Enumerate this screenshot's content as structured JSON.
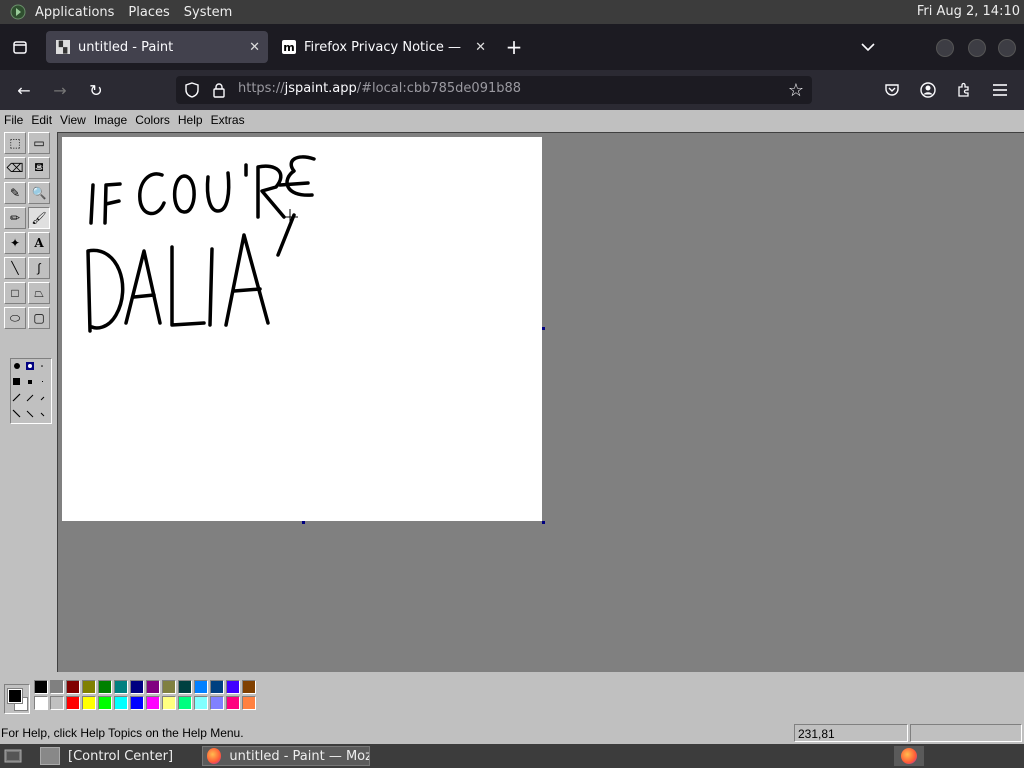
{
  "top_panel": {
    "menus": [
      "Applications",
      "Places",
      "System"
    ],
    "clock": "Fri Aug  2, 14:10"
  },
  "browser": {
    "tabs": [
      {
        "title": "untitled - Paint",
        "active": true,
        "icon": "paint-favicon"
      },
      {
        "title": "Firefox Privacy Notice — Mo",
        "active": false,
        "icon": "mozilla-m-favicon",
        "favicon_text": "m"
      }
    ],
    "new_tab_label": "+",
    "url": {
      "scheme": "https://",
      "host": "jspaint.app",
      "path": "/#local:cbb785de091b88"
    }
  },
  "paint": {
    "menu": [
      "File",
      "Edit",
      "View",
      "Image",
      "Colors",
      "Help",
      "Extras"
    ],
    "tools": [
      {
        "name": "free-form-select",
        "glyph": "⬚"
      },
      {
        "name": "rect-select",
        "glyph": "▭"
      },
      {
        "name": "eraser",
        "glyph": "⌫"
      },
      {
        "name": "fill",
        "glyph": "⛾"
      },
      {
        "name": "pick-color",
        "glyph": "✎"
      },
      {
        "name": "magnifier",
        "glyph": "🔍"
      },
      {
        "name": "pencil",
        "glyph": "✏"
      },
      {
        "name": "brush",
        "glyph": "🖌"
      },
      {
        "name": "airbrush",
        "glyph": "✦"
      },
      {
        "name": "text",
        "glyph": "A"
      },
      {
        "name": "line",
        "glyph": "╲"
      },
      {
        "name": "curve",
        "glyph": "∫"
      },
      {
        "name": "rectangle",
        "glyph": "□"
      },
      {
        "name": "polygon",
        "glyph": "⏢"
      },
      {
        "name": "ellipse",
        "glyph": "⬭"
      },
      {
        "name": "rounded-rectangle",
        "glyph": "▢"
      }
    ],
    "palette_top": [
      "#000000",
      "#808080",
      "#800000",
      "#808000",
      "#008000",
      "#008080",
      "#000080",
      "#800080",
      "#808040",
      "#004040",
      "#0080ff",
      "#004080",
      "#4000ff",
      "#804000"
    ],
    "palette_bottom": [
      "#ffffff",
      "#c0c0c0",
      "#ff0000",
      "#ffff00",
      "#00ff00",
      "#00ffff",
      "#0000ff",
      "#ff00ff",
      "#ffff80",
      "#00ff80",
      "#80ffff",
      "#8080ff",
      "#ff0080",
      "#ff8040"
    ],
    "foreground": "#000000",
    "background": "#ffffff",
    "status_help": "For Help, click Help Topics on the Help Menu.",
    "status_coords": "231,81"
  },
  "taskbar": {
    "items": [
      {
        "label": "[Control Center]",
        "active": false
      },
      {
        "label": "untitled - Paint — Moz...",
        "active": true
      }
    ]
  }
}
